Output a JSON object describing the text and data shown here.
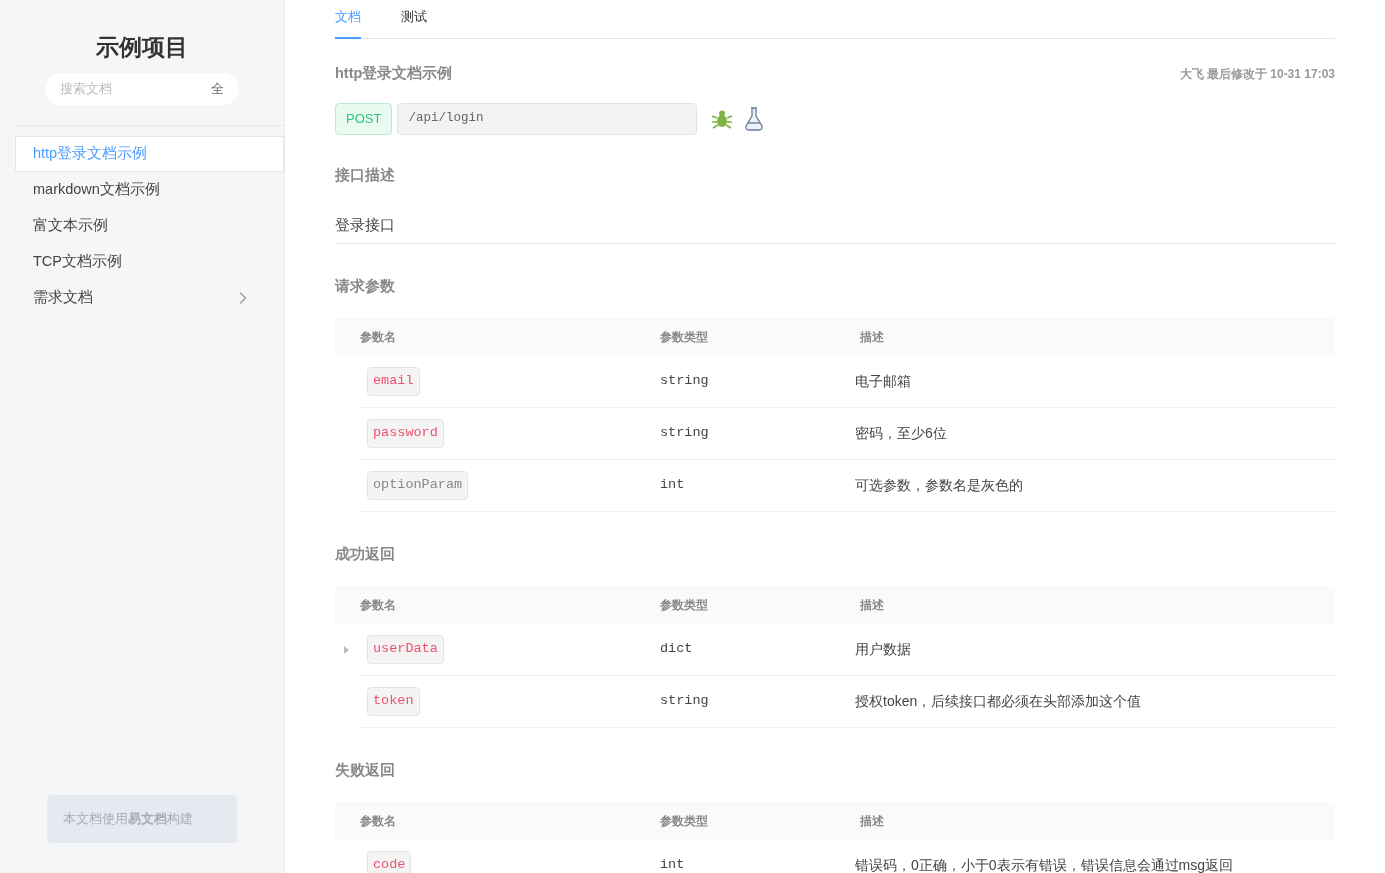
{
  "sidebar": {
    "project_title": "示例项目",
    "search": {
      "placeholder": "搜索文档",
      "scope": "全"
    },
    "items": [
      {
        "label": "http登录文档示例",
        "selected": true,
        "has_children": false
      },
      {
        "label": "markdown文档示例",
        "selected": false,
        "has_children": false
      },
      {
        "label": "富文本示例",
        "selected": false,
        "has_children": false
      },
      {
        "label": "TCP文档示例",
        "selected": false,
        "has_children": false
      },
      {
        "label": "需求文档",
        "selected": false,
        "has_children": true
      }
    ],
    "footer": "本文档使用 **易文档** 构建"
  },
  "tabs": [
    {
      "label": "文档",
      "selected": true
    },
    {
      "label": "测试",
      "selected": false
    }
  ],
  "doc": {
    "title": "http登录文档示例",
    "meta": "大飞 最后修改于 10-31 17:03",
    "method": "POST",
    "url": "/api/login",
    "description_heading": "接口描述",
    "description": "登录接口",
    "sections": [
      {
        "heading": "请求参数",
        "columns": [
          "参数名",
          "参数类型",
          "描述"
        ],
        "rows": [
          {
            "name": "email",
            "required": true,
            "expandable": false,
            "type": "string",
            "description": "电子邮箱"
          },
          {
            "name": "password",
            "required": true,
            "expandable": false,
            "type": "string",
            "description": "密码，至少6位"
          },
          {
            "name": "optionParam",
            "required": false,
            "expandable": false,
            "type": "int",
            "description": "可选参数，参数名是灰色的"
          }
        ]
      },
      {
        "heading": "成功返回",
        "columns": [
          "参数名",
          "参数类型",
          "描述"
        ],
        "rows": [
          {
            "name": "userData",
            "required": true,
            "expandable": true,
            "type": "dict",
            "description": "用户数据"
          },
          {
            "name": "token",
            "required": true,
            "expandable": false,
            "type": "string",
            "description": "授权token，后续接口都必须在头部添加这个值"
          }
        ]
      },
      {
        "heading": "失败返回",
        "columns": [
          "参数名",
          "参数类型",
          "描述"
        ],
        "rows": [
          {
            "name": "code",
            "required": true,
            "expandable": false,
            "type": "int",
            "description": "错误码，0正确，小于0表示有错误，错误信息会通过msg返回"
          }
        ]
      }
    ]
  }
}
